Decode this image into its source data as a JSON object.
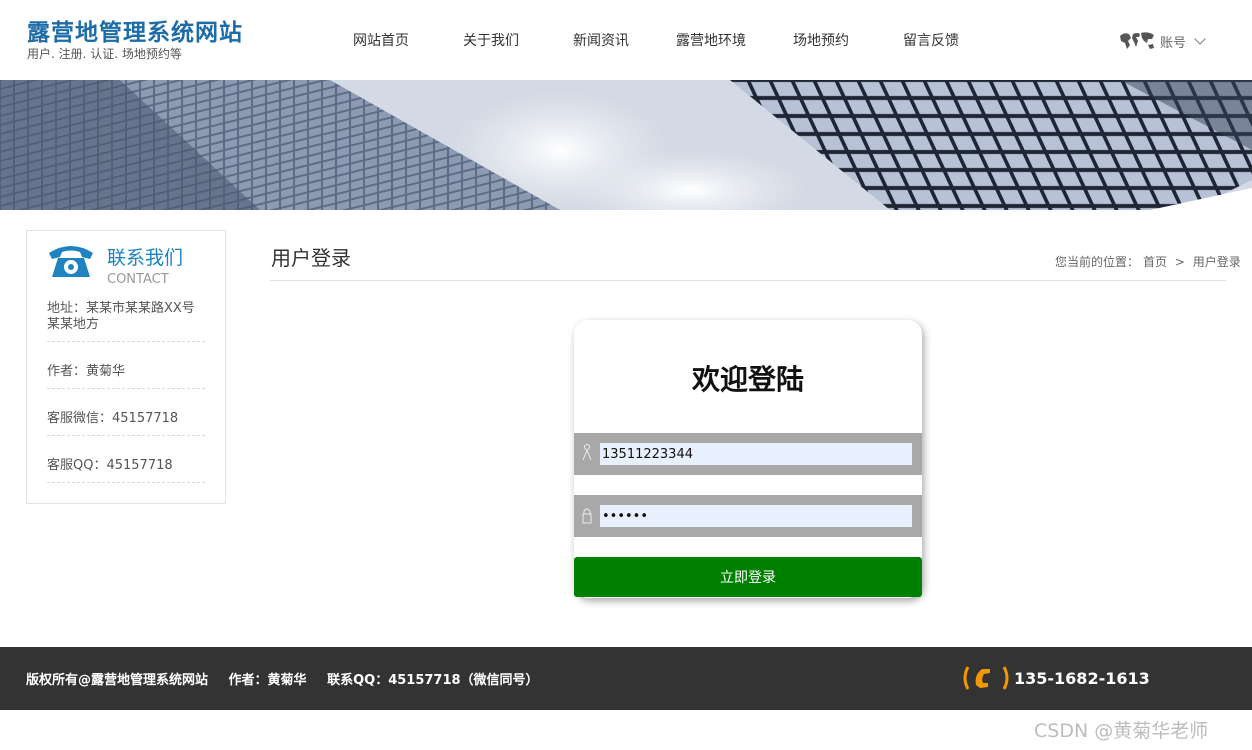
{
  "header": {
    "site_title": "露营地管理系统网站",
    "site_subtitle": "用户. 注册. 认证. 场地预约等",
    "nav": [
      "网站首页",
      "关于我们",
      "新闻资讯",
      "露营地环境",
      "场地预约",
      "留言反馈"
    ],
    "account_label": "账号"
  },
  "sidebar": {
    "title": "联系我们",
    "title_en": "CONTACT",
    "items": [
      "地址：某某市某某路XX号某某地方",
      "作者：黄菊华",
      "客服微信：45157718",
      "客服QQ：45157718"
    ]
  },
  "main": {
    "title": "用户登录",
    "breadcrumb": {
      "prefix": "您当前的位置：",
      "home": "首页",
      "separator": ">",
      "current": "用户登录"
    }
  },
  "login": {
    "heading": "欢迎登陆",
    "username_value": "13511223344",
    "password_value": "••••••",
    "submit_label": "立即登录"
  },
  "footer": {
    "copyright": "版权所有@露营地管理系统网站",
    "author": "作者：黄菊华",
    "contact": "联系QQ：45157718（微信同号）",
    "phone": "135-1682-1613"
  },
  "watermark": "CSDN @黄菊华老师",
  "colors": {
    "brand_blue": "#1d6ca8",
    "login_button": "#008000",
    "footer_bg": "#333333",
    "phone_accent": "#f39800"
  }
}
